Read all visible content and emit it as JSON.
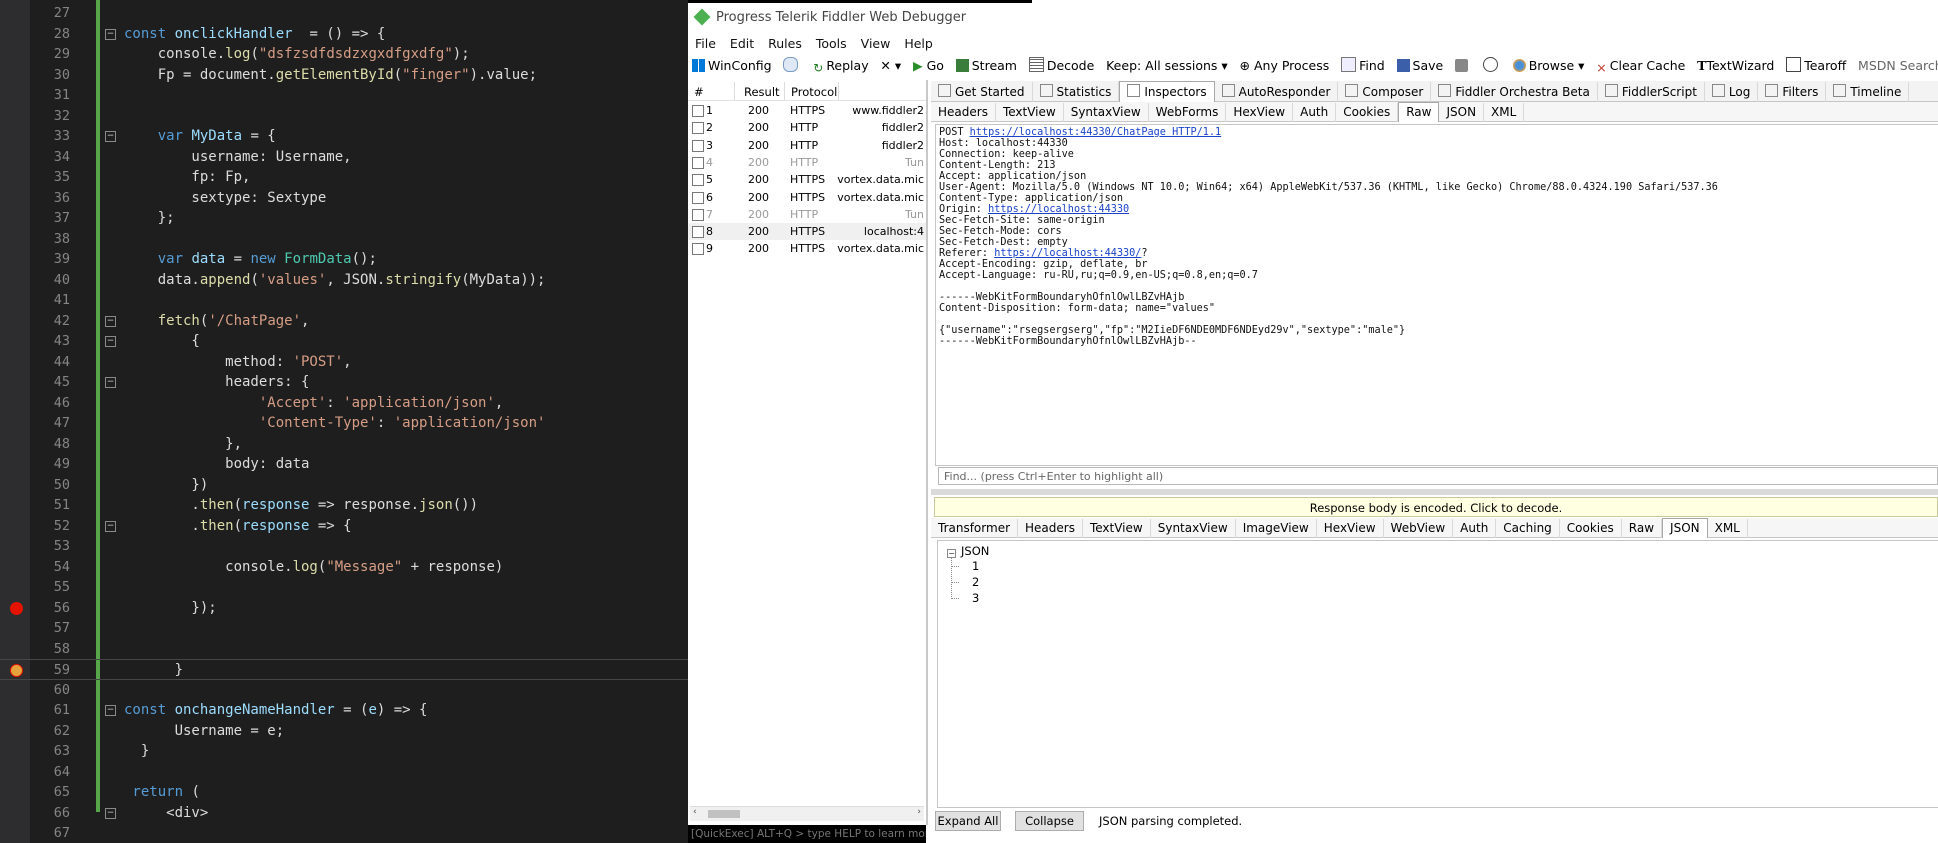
{
  "editor": {
    "lines": [
      {
        "n": "27",
        "code": []
      },
      {
        "n": "28",
        "fold": "−",
        "code": [
          [
            "k",
            "const "
          ],
          [
            "p",
            "onclickHandler"
          ],
          [
            "",
            "  = () => {"
          ]
        ]
      },
      {
        "n": "29",
        "code": [
          [
            "",
            "    console."
          ],
          [
            "f",
            "log"
          ],
          [
            "",
            "("
          ],
          [
            "s",
            "\"dsfzsdfdsdzxgxdfgxdfg\""
          ],
          [
            "",
            ");"
          ]
        ]
      },
      {
        "n": "30",
        "code": [
          [
            "",
            "    Fp = document."
          ],
          [
            "f",
            "getElementById"
          ],
          [
            "",
            "("
          ],
          [
            "s",
            "\"finger\""
          ],
          [
            "",
            ").value;"
          ]
        ]
      },
      {
        "n": "31",
        "code": []
      },
      {
        "n": "32",
        "code": []
      },
      {
        "n": "33",
        "fold": "−",
        "code": [
          [
            "k",
            "    var "
          ],
          [
            "p",
            "MyData"
          ],
          [
            "",
            " = {"
          ]
        ]
      },
      {
        "n": "34",
        "code": [
          [
            "",
            "        username: Username,"
          ]
        ]
      },
      {
        "n": "35",
        "code": [
          [
            "",
            "        fp: Fp,"
          ]
        ]
      },
      {
        "n": "36",
        "code": [
          [
            "",
            "        sextype: Sextype"
          ]
        ]
      },
      {
        "n": "37",
        "code": [
          [
            "",
            "    };"
          ]
        ]
      },
      {
        "n": "38",
        "code": []
      },
      {
        "n": "39",
        "code": [
          [
            "k",
            "    var "
          ],
          [
            "p",
            "data"
          ],
          [
            "",
            " = "
          ],
          [
            "k",
            "new "
          ],
          [
            "t",
            "FormData"
          ],
          [
            "",
            "();"
          ]
        ]
      },
      {
        "n": "40",
        "code": [
          [
            "",
            "    data."
          ],
          [
            "f",
            "append"
          ],
          [
            "",
            "("
          ],
          [
            "s",
            "'values'"
          ],
          [
            "",
            ", JSON."
          ],
          [
            "f",
            "stringify"
          ],
          [
            "",
            "(MyData));"
          ]
        ]
      },
      {
        "n": "41",
        "code": []
      },
      {
        "n": "42",
        "fold": "−",
        "code": [
          [
            "",
            "    "
          ],
          [
            "f",
            "fetch"
          ],
          [
            "",
            "("
          ],
          [
            "s",
            "'/ChatPage'"
          ],
          [
            "",
            ","
          ]
        ]
      },
      {
        "n": "43",
        "fold": "−",
        "code": [
          [
            "",
            "        {"
          ]
        ]
      },
      {
        "n": "44",
        "code": [
          [
            "",
            "            method: "
          ],
          [
            "s",
            "'POST'"
          ],
          [
            "",
            ","
          ]
        ]
      },
      {
        "n": "45",
        "fold": "−",
        "code": [
          [
            "",
            "            headers: {"
          ]
        ]
      },
      {
        "n": "46",
        "code": [
          [
            "",
            "                "
          ],
          [
            "s",
            "'Accept'"
          ],
          [
            "",
            ": "
          ],
          [
            "s",
            "'application/json'"
          ],
          [
            "",
            ","
          ]
        ]
      },
      {
        "n": "47",
        "code": [
          [
            "",
            "                "
          ],
          [
            "s",
            "'Content-Type'"
          ],
          [
            "",
            ": "
          ],
          [
            "s",
            "'application/json'"
          ]
        ]
      },
      {
        "n": "48",
        "code": [
          [
            "",
            "            },"
          ]
        ]
      },
      {
        "n": "49",
        "code": [
          [
            "",
            "            body: data"
          ]
        ]
      },
      {
        "n": "50",
        "code": [
          [
            "",
            "        })"
          ]
        ]
      },
      {
        "n": "51",
        "code": [
          [
            "",
            "        ."
          ],
          [
            "f",
            "then"
          ],
          [
            "",
            "("
          ],
          [
            "p",
            "response"
          ],
          [
            "",
            " => response."
          ],
          [
            "f",
            "json"
          ],
          [
            "",
            "())"
          ]
        ]
      },
      {
        "n": "52",
        "fold": "−",
        "code": [
          [
            "",
            "        ."
          ],
          [
            "f",
            "then"
          ],
          [
            "",
            "("
          ],
          [
            "p",
            "response"
          ],
          [
            "",
            " => {"
          ]
        ]
      },
      {
        "n": "53",
        "code": []
      },
      {
        "n": "54",
        "code": [
          [
            "",
            "            console."
          ],
          [
            "f",
            "log"
          ],
          [
            "",
            "("
          ],
          [
            "s",
            "\"Message\""
          ],
          [
            "",
            " + response)"
          ]
        ]
      },
      {
        "n": "55",
        "code": []
      },
      {
        "n": "56",
        "bp": "red",
        "code": [
          [
            "",
            "        });"
          ]
        ]
      },
      {
        "n": "57",
        "code": []
      },
      {
        "n": "58",
        "code": []
      },
      {
        "n": "59",
        "bp": "current",
        "current": true,
        "code": [
          [
            "",
            "      }"
          ]
        ]
      },
      {
        "n": "60",
        "code": []
      },
      {
        "n": "61",
        "fold": "−",
        "code": [
          [
            "k",
            "const "
          ],
          [
            "p",
            "onchangeNameHandler"
          ],
          [
            "",
            " = ("
          ],
          [
            "p",
            "e"
          ],
          [
            "",
            ") => {"
          ]
        ]
      },
      {
        "n": "62",
        "code": [
          [
            "",
            "      Username = e;"
          ]
        ]
      },
      {
        "n": "63",
        "code": [
          [
            "",
            "  }"
          ]
        ]
      },
      {
        "n": "64",
        "code": []
      },
      {
        "n": "65",
        "code": [
          [
            "k",
            " return "
          ],
          [
            "",
            "("
          ]
        ]
      },
      {
        "n": "66",
        "fold": "−",
        "code": [
          [
            "",
            "     <div>"
          ]
        ]
      },
      {
        "n": "67",
        "code": []
      }
    ]
  },
  "fiddler": {
    "title": "Progress Telerik Fiddler Web Debugger",
    "menu": [
      "File",
      "Edit",
      "Rules",
      "Tools",
      "View",
      "Help"
    ],
    "toolbar": [
      "WinConfig",
      "Replay",
      "✕ ▾",
      "Go",
      "Stream",
      "Decode",
      "Keep: All sessions ▾",
      "Any Process",
      "Find",
      "Save",
      "Browse ▾",
      "Clear Cache",
      "TextWizard",
      "Tearoff",
      "MSDN Search..."
    ],
    "sessions_header": {
      "num": "#",
      "result": "Result",
      "protocol": "Protocol"
    },
    "sessions": [
      {
        "num": "1",
        "result": "200",
        "protocol": "HTTPS",
        "host": "www.fiddler2"
      },
      {
        "num": "2",
        "result": "200",
        "protocol": "HTTP",
        "host": "fiddler2"
      },
      {
        "num": "3",
        "result": "200",
        "protocol": "HTTP",
        "host": "fiddler2"
      },
      {
        "num": "4",
        "result": "200",
        "protocol": "HTTP",
        "host": "Tun",
        "grey": true
      },
      {
        "num": "5",
        "result": "200",
        "protocol": "HTTPS",
        "host": "vortex.data.mic"
      },
      {
        "num": "6",
        "result": "200",
        "protocol": "HTTPS",
        "host": "vortex.data.mic"
      },
      {
        "num": "7",
        "result": "200",
        "protocol": "HTTP",
        "host": "Tun",
        "grey": true
      },
      {
        "num": "8",
        "result": "200",
        "protocol": "HTTPS",
        "host": "localhost:4",
        "sel": true
      },
      {
        "num": "9",
        "result": "200",
        "protocol": "HTTPS",
        "host": "vortex.data.mic"
      }
    ],
    "quickexec": "[QuickExec] ALT+Q > type HELP to learn more",
    "main_tabs": [
      "Get Started",
      "Statistics",
      "Inspectors",
      "AutoResponder",
      "Composer",
      "Fiddler Orchestra Beta",
      "FiddlerScript",
      "Log",
      "Filters",
      "Timeline"
    ],
    "main_tab_active": "Inspectors",
    "request_tabs": [
      "Headers",
      "TextView",
      "SyntaxView",
      "WebForms",
      "HexView",
      "Auth",
      "Cookies",
      "Raw",
      "JSON",
      "XML"
    ],
    "request_tab_active": "Raw",
    "raw_request": {
      "line1_method": "POST ",
      "line1_url": "https://localhost:44330/ChatPage HTTP/1.1",
      "host": "Host: localhost:44330",
      "connection": "Connection: keep-alive",
      "content_length": "Content-Length: 213",
      "accept": "Accept: application/json",
      "user_agent": "User-Agent: Mozilla/5.0 (Windows NT 10.0; Win64; x64) AppleWebKit/537.36 (KHTML, like Gecko) Chrome/88.0.4324.190 Safari/537.36",
      "content_type": "Content-Type: application/json",
      "origin_label": "Origin: ",
      "origin_url": "https://localhost:44330",
      "fetch_site": "Sec-Fetch-Site: same-origin",
      "fetch_mode": "Sec-Fetch-Mode: cors",
      "fetch_dest": "Sec-Fetch-Dest: empty",
      "referer_label": "Referer: ",
      "referer_url": "https://localhost:44330/",
      "referer_tail": "?",
      "accept_encoding": "Accept-Encoding: gzip, deflate, br",
      "accept_language": "Accept-Language: ru-RU,ru;q=0.9,en-US;q=0.8,en;q=0.7",
      "boundary": "------WebKitFormBoundaryhOfnlOwlLBZvHAjb",
      "disposition": "Content-Disposition: form-data; name=\"values\"",
      "body": "{\"username\":\"rsegsergserg\",\"fp\":\"M2IieDF6NDE0MDF6NDEyd29v\",\"sextype\":\"male\"}",
      "boundary_end": "------WebKitFormBoundaryhOfnlOwlLBZvHAjb--"
    },
    "find_placeholder": "Find... (press Ctrl+Enter to highlight all)",
    "encoded_notice": "Response body is encoded. Click to decode.",
    "response_tabs": [
      "Transformer",
      "Headers",
      "TextView",
      "SyntaxView",
      "ImageView",
      "HexView",
      "WebView",
      "Auth",
      "Caching",
      "Cookies",
      "Raw",
      "JSON",
      "XML"
    ],
    "response_tab_active": "JSON",
    "json_tree": {
      "root": "JSON",
      "children": [
        "1",
        "2",
        "3"
      ]
    },
    "expand_all": "Expand All",
    "collapse": "Collapse",
    "status": "JSON parsing completed."
  }
}
